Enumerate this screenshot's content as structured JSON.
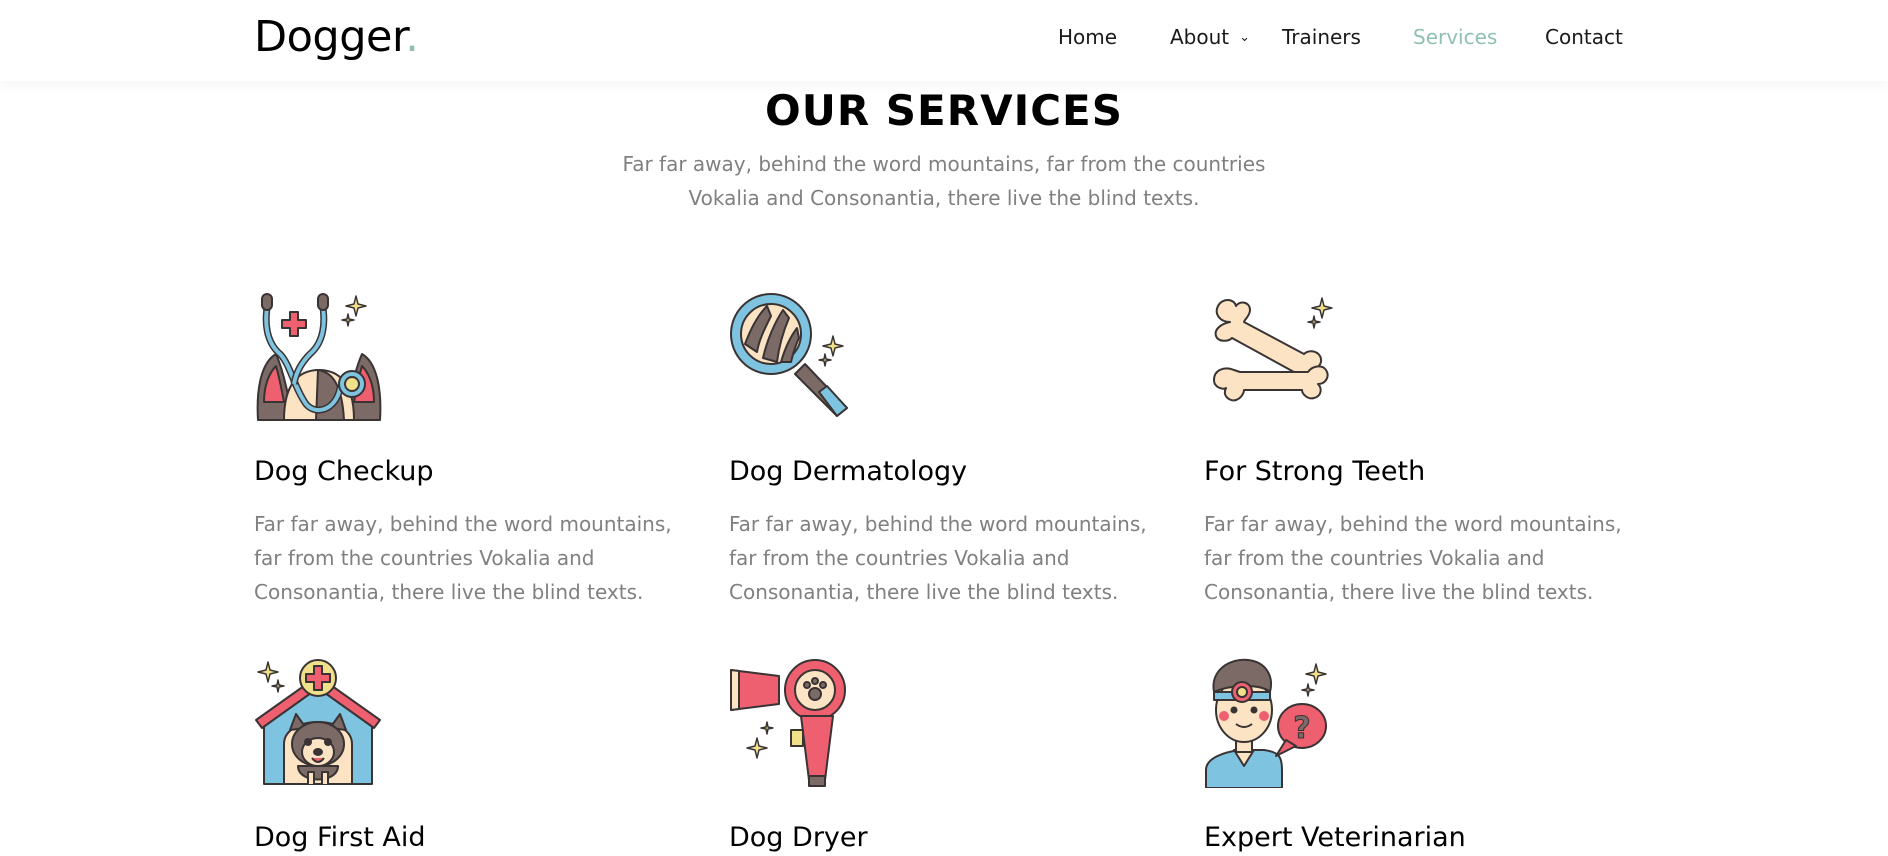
{
  "brand": {
    "name": "Dogger",
    "dot": "."
  },
  "nav": {
    "items": [
      {
        "label": "Home",
        "active": false
      },
      {
        "label": "About",
        "active": false,
        "dropdown": true
      },
      {
        "label": "Trainers",
        "active": false
      },
      {
        "label": "Services",
        "active": true
      },
      {
        "label": "Contact",
        "active": false
      }
    ]
  },
  "section": {
    "title": "OUR SERVICES",
    "subtitle": "Far far away, behind the word mountains, far from the countries Vokalia and Consonantia, there live the blind texts."
  },
  "services": [
    {
      "title": "Dog Checkup",
      "text": "Far far away, behind the word mountains, far from the countries Vokalia and Consonantia, there live the blind texts.",
      "icon": "stethoscope-dog-icon"
    },
    {
      "title": "Dog Dermatology",
      "text": "Far far away, behind the word mountains, far from the countries Vokalia and Consonantia, there live the blind texts.",
      "icon": "magnifier-fur-icon"
    },
    {
      "title": "For Strong Teeth",
      "text": "Far far away, behind the word mountains, far from the countries Vokalia and Consonantia, there live the blind texts.",
      "icon": "bones-icon"
    },
    {
      "title": "Dog First Aid",
      "text": "",
      "icon": "doghouse-first-aid-icon"
    },
    {
      "title": "Dog Dryer",
      "text": "",
      "icon": "hair-dryer-icon"
    },
    {
      "title": "Expert Veterinarian",
      "text": "",
      "icon": "veterinarian-icon"
    }
  ],
  "colors": {
    "accent": "#8fbfb5",
    "muted_text": "#808080",
    "icon_blue": "#7ec3df",
    "icon_pink": "#ee6070",
    "icon_cream": "#fbe3c4",
    "icon_brown": "#7b6a66",
    "icon_yellow": "#f1e08a"
  }
}
